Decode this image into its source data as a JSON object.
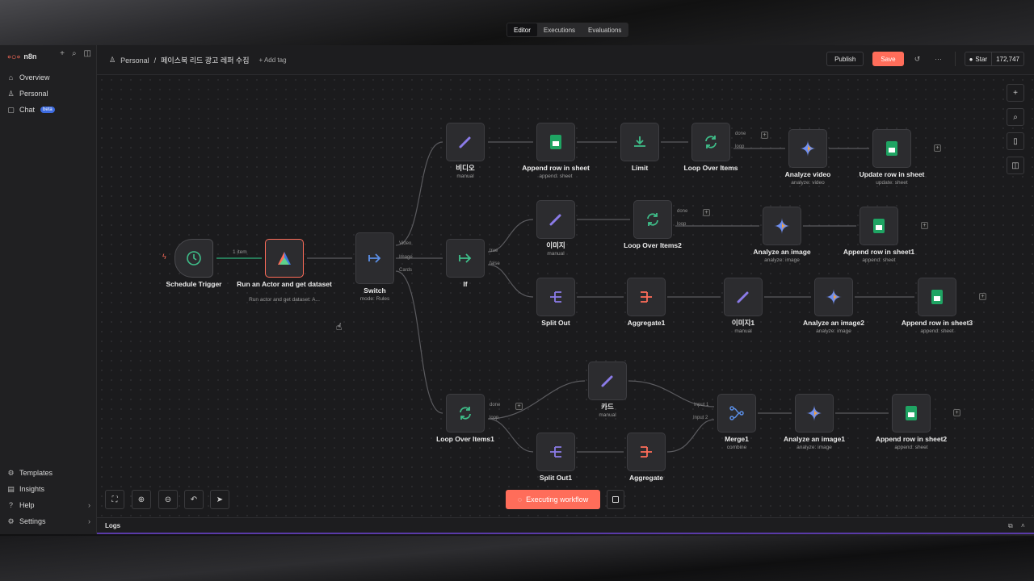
{
  "sidebar": {
    "brand": "n8n",
    "nav": [
      {
        "label": "Overview",
        "icon": "home-icon"
      },
      {
        "label": "Personal",
        "icon": "user-icon"
      },
      {
        "label": "Chat",
        "icon": "chat-icon",
        "badge": "beta"
      }
    ],
    "bottom": [
      {
        "label": "Templates",
        "icon": "templates-icon"
      },
      {
        "label": "Insights",
        "icon": "insights-icon"
      },
      {
        "label": "Help",
        "icon": "help-icon"
      },
      {
        "label": "Settings",
        "icon": "settings-icon"
      }
    ]
  },
  "header": {
    "crumb_owner": "Personal",
    "workflow_title": "페이스북 리드 광고 레퍼 수집",
    "add_tag": "+ Add tag",
    "publish": "Publish",
    "save": "Save",
    "github_star": "Star",
    "github_count": "172,747"
  },
  "tabs": [
    "Editor",
    "Executions",
    "Evaluations"
  ],
  "nodes": {
    "schedule": {
      "label": "Schedule Trigger",
      "edge_label": "1 item"
    },
    "actor": {
      "label": "Run an Actor and get dataset",
      "sub": "Run actor and get dataset: A..."
    },
    "switch": {
      "label": "Switch",
      "sub": "mode: Rules",
      "out1": "Video",
      "out2": "Image",
      "out3": "Cards"
    },
    "if": {
      "label": "If",
      "out_true": "true",
      "out_false": "false"
    },
    "video": {
      "label": "비디오",
      "sub": "manual"
    },
    "append_sheet": {
      "label": "Append row in sheet",
      "sub": "append: sheet"
    },
    "limit": {
      "label": "Limit"
    },
    "loop": {
      "label": "Loop Over Items",
      "done": "done",
      "loop": "loop"
    },
    "analyze_video": {
      "label": "Analyze video",
      "sub": "analyze: video"
    },
    "update_row": {
      "label": "Update row in sheet",
      "sub": "update: sheet"
    },
    "image": {
      "label": "이미지",
      "sub": "manual"
    },
    "loop2": {
      "label": "Loop Over Items2",
      "done": "done",
      "loop": "loop"
    },
    "analyze_image": {
      "label": "Analyze an image",
      "sub": "analyze: image"
    },
    "append_sheet1": {
      "label": "Append row in sheet1",
      "sub": "append: sheet"
    },
    "split_out": {
      "label": "Split Out"
    },
    "aggregate1": {
      "label": "Aggregate1"
    },
    "image1": {
      "label": "이미지1",
      "sub": "manual"
    },
    "analyze_image2": {
      "label": "Analyze an image2",
      "sub": "analyze: image"
    },
    "append_sheet3": {
      "label": "Append row in sheet3",
      "sub": "append: sheet"
    },
    "card": {
      "label": "카드",
      "sub": "manual"
    },
    "loop1": {
      "label": "Loop Over Items1",
      "done": "done",
      "loop": "loop"
    },
    "split_out1": {
      "label": "Split Out1"
    },
    "aggregate": {
      "label": "Aggregate"
    },
    "merge1": {
      "label": "Merge1",
      "sub": "combine",
      "in1": "Input 1",
      "in2": "Input 2"
    },
    "analyze_image1": {
      "label": "Analyze an image1",
      "sub": "analyze: image"
    },
    "append_sheet2": {
      "label": "Append row in sheet2",
      "sub": "append: sheet"
    }
  },
  "footer": {
    "executing": "Executing workflow",
    "logs": "Logs"
  },
  "colors": {
    "accent": "#ff6d5a",
    "sheets": "#1fa463",
    "canvas": "#1b1b1d"
  }
}
